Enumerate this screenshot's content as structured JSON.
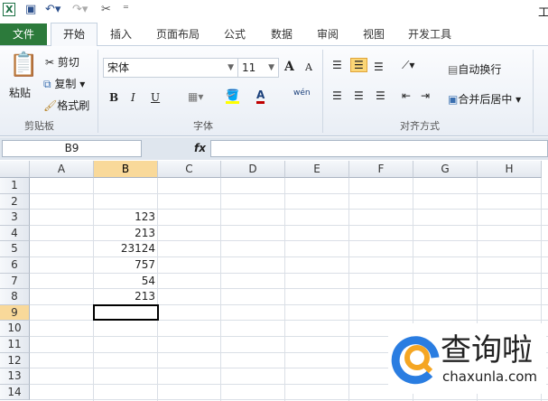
{
  "quick_access": {
    "title_fragment": "工"
  },
  "tabs": [
    "文件",
    "开始",
    "插入",
    "页面布局",
    "公式",
    "数据",
    "审阅",
    "视图",
    "开发工具"
  ],
  "clipboard": {
    "paste": "粘贴",
    "cut": "剪切",
    "copy": "复制",
    "format_painter": "格式刷",
    "group": "剪贴板"
  },
  "font": {
    "name": "宋体",
    "size": "11",
    "bold": "B",
    "italic": "I",
    "underline": "U",
    "group": "字体",
    "grow": "A",
    "shrink": "A",
    "font_color": "A",
    "phonetic": "wén"
  },
  "alignment": {
    "wrap": "自动换行",
    "merge": "合并后居中",
    "group": "对齐方式"
  },
  "colors": {
    "file_tab": "#2c7a3b",
    "selected_header": "#f9d99a",
    "highlight": "#ffff00",
    "font_color": "#c00000"
  },
  "formula_bar": {
    "name_box": "B9",
    "fx": "fx",
    "value": ""
  },
  "columns": [
    "A",
    "B",
    "C",
    "D",
    "E",
    "F",
    "G",
    "H"
  ],
  "rows": [
    "1",
    "2",
    "3",
    "4",
    "5",
    "6",
    "7",
    "8",
    "9",
    "10",
    "11",
    "12",
    "13",
    "14"
  ],
  "cells": {
    "B3": "123",
    "B4": "213",
    "B5": "23124",
    "B6": "757",
    "B7": "54",
    "B8": "213"
  },
  "selected_cell": "B9",
  "watermark": {
    "name": "查询啦",
    "url": "chaxunla.com"
  }
}
